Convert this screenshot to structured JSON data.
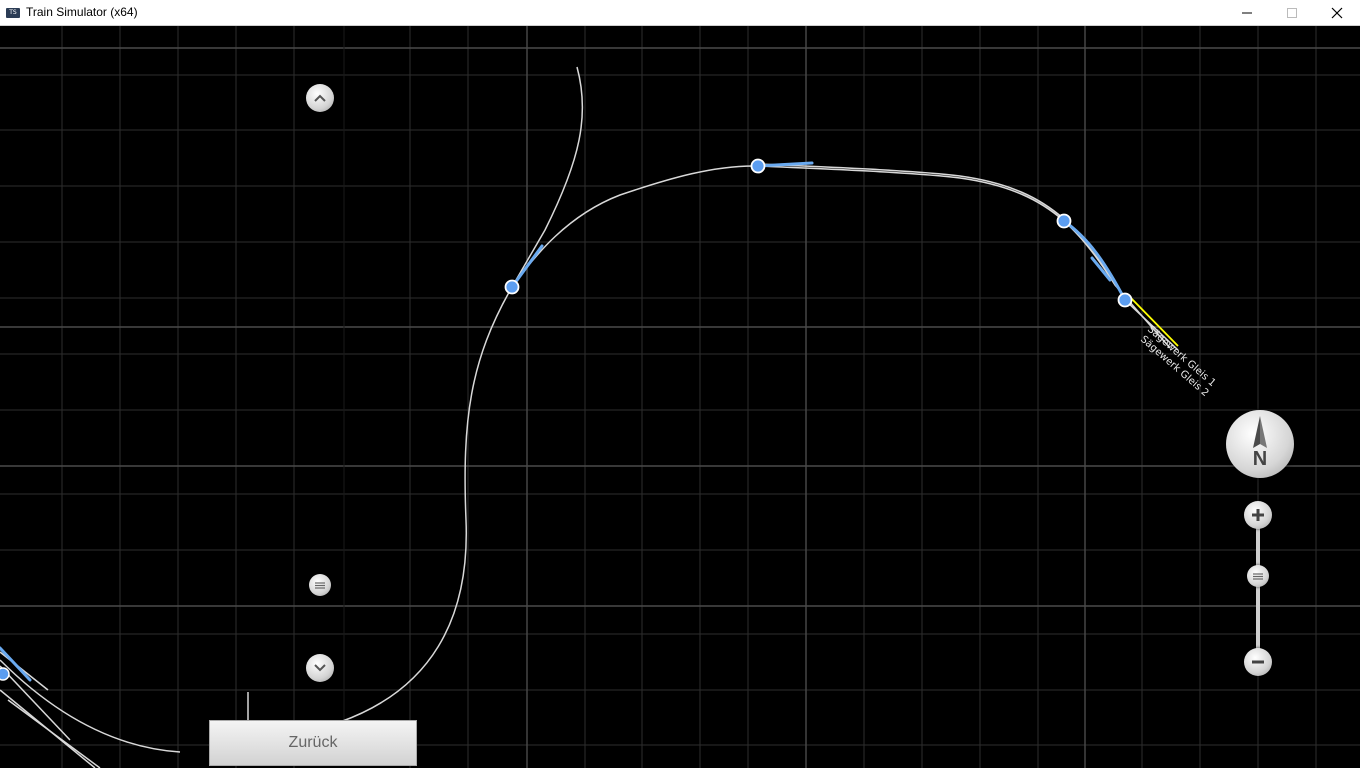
{
  "window": {
    "title": "Train Simulator (x64)",
    "app_icon": "TS",
    "controls": {
      "minimize_icon": "minimize-icon",
      "maximize_icon": "maximize-icon",
      "close_icon": "close-icon"
    }
  },
  "map": {
    "track_labels": [
      "Sägewerk Gleis 1",
      "Sägewerk Gleis 2"
    ],
    "colors": {
      "background": "#000000",
      "grid": "#3a3a3a",
      "track": "#d8d8d8",
      "selection": "#6aaaf0",
      "label_highlight": "#ffff00"
    }
  },
  "compass": {
    "label": "N"
  },
  "zoom": {
    "in_icon": "plus-icon",
    "out_icon": "minus-icon"
  },
  "scroll": {
    "up_icon": "chevron-up-icon",
    "down_icon": "chevron-down-icon"
  },
  "footer": {
    "back_label": "Zurück"
  }
}
